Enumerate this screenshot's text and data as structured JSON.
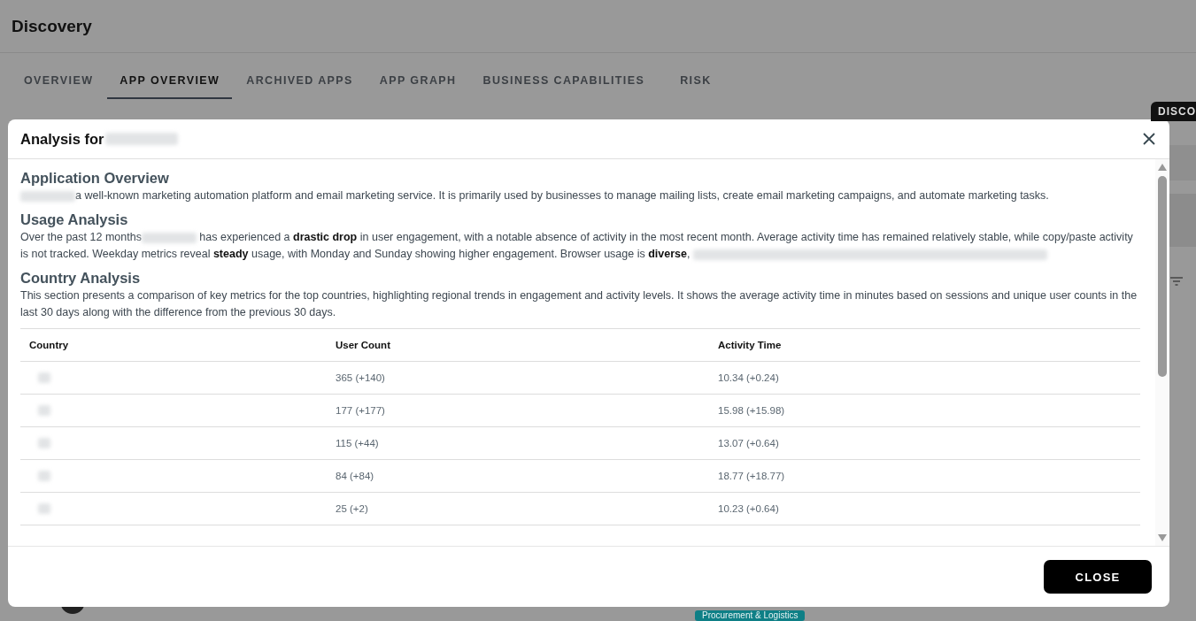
{
  "page": {
    "title": "Discovery",
    "tabs": [
      {
        "label": "OVERVIEW",
        "selected": false
      },
      {
        "label": "APP OVERVIEW",
        "selected": true
      },
      {
        "label": "ARCHIVED APPS",
        "selected": false
      },
      {
        "label": "APP GRAPH",
        "selected": false
      },
      {
        "label": "BUSINESS CAPABILITIES",
        "selected": false
      },
      {
        "label": "RISK",
        "selected": false
      }
    ],
    "badge": "DISCO",
    "tag": "Procurement & Logistics"
  },
  "dialog": {
    "title": "Analysis for",
    "sections": [
      {
        "heading": "Application Overview",
        "paragraphs": [
          [
            {
              "kind": "blur"
            },
            {
              "kind": "text",
              "text": "a well-known marketing automation platform and email marketing service. It is primarily used by businesses to manage mailing lists, create email marketing campaigns, and automate marketing tasks."
            }
          ]
        ]
      },
      {
        "heading": "Usage Analysis",
        "paragraphs": [
          [
            {
              "kind": "text",
              "text": "Over the past 12 months"
            },
            {
              "kind": "blur"
            },
            {
              "kind": "text",
              "text": " has experienced a **drastic drop** in user engagement, with a notable absence of activity in the most recent month. Average activity time has remained relatively stable, while copy/paste activity is not tracked. Weekday metrics reveal **steady** usage, with Monday and Sunday showing higher engagement. Browser usage is **diverse**,"
            },
            {
              "kind": "longblur"
            }
          ]
        ]
      },
      {
        "heading": "Country Analysis",
        "paragraphs": [
          [
            {
              "kind": "text",
              "text": "This section presents a comparison of key metrics for the top countries, highlighting regional trends in engagement and activity levels. It shows the average activity time in minutes based on sessions and unique user counts in the last 30 days along with the difference from the previous 30 days."
            }
          ]
        ]
      }
    ],
    "table": {
      "columns": [
        "Country",
        "User Count",
        "Activity Time"
      ],
      "rows": [
        {
          "user_count": "365 (+140)",
          "activity_time": "10.34 (+0.24)"
        },
        {
          "user_count": "177 (+177)",
          "activity_time": "15.98 (+15.98)"
        },
        {
          "user_count": "115 (+44)",
          "activity_time": "13.07 (+0.64)"
        },
        {
          "user_count": "84 (+84)",
          "activity_time": "18.77 (+18.77)"
        },
        {
          "user_count": "25 (+2)",
          "activity_time": "10.23 (+0.64)"
        }
      ]
    },
    "close_button": "CLOSE"
  }
}
